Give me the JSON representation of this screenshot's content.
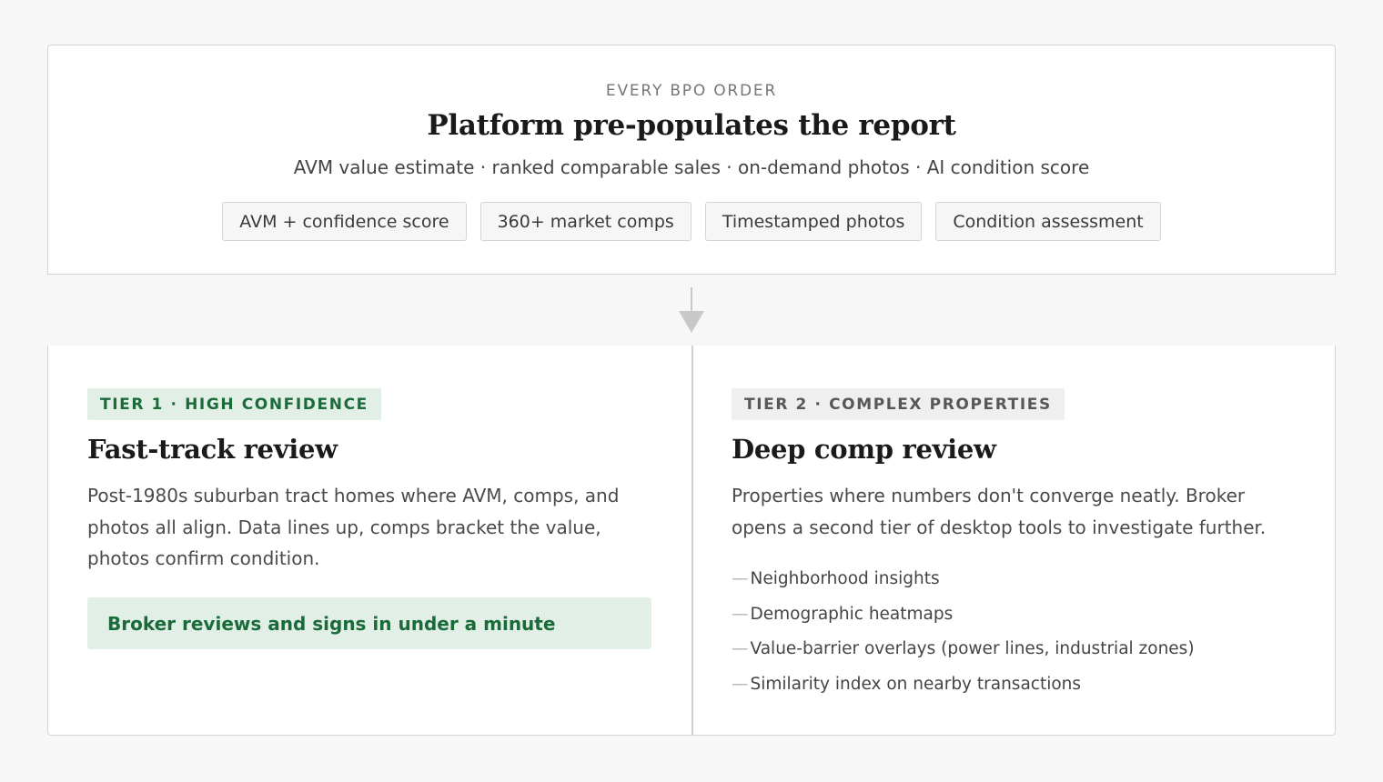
{
  "top": {
    "eyebrow": "EVERY BPO ORDER",
    "title": "Platform pre-populates the report",
    "subtitle": "AVM value estimate · ranked comparable sales · on-demand photos · AI condition score",
    "chips": [
      "AVM + confidence score",
      "360+ market comps",
      "Timestamped photos",
      "Condition assessment"
    ]
  },
  "tier1": {
    "tag": "TIER 1 · HIGH CONFIDENCE",
    "title": "Fast-track review",
    "body": "Post-1980s suburban tract homes where AVM, comps, and photos all align. Data lines up, comps bracket the value, photos confirm condition.",
    "callout": "Broker reviews and signs in under a minute"
  },
  "tier2": {
    "tag": "TIER 2 · COMPLEX PROPERTIES",
    "title": "Deep comp review",
    "body": "Properties where numbers don't converge neatly. Broker opens a second tier of desktop tools to investigate further.",
    "dash": "—",
    "tools": [
      "Neighborhood insights",
      "Demographic heatmaps",
      "Value-barrier overlays (power lines, industrial zones)",
      "Similarity index on nearby transactions"
    ]
  },
  "colors": {
    "tier1_accent": "#1b6b3a",
    "tier1_bg": "#e1efe6",
    "tier2_bg": "#efefef",
    "arrow": "#c8c8c8"
  },
  "icons": {
    "flow_arrow": "down-arrow-icon"
  }
}
